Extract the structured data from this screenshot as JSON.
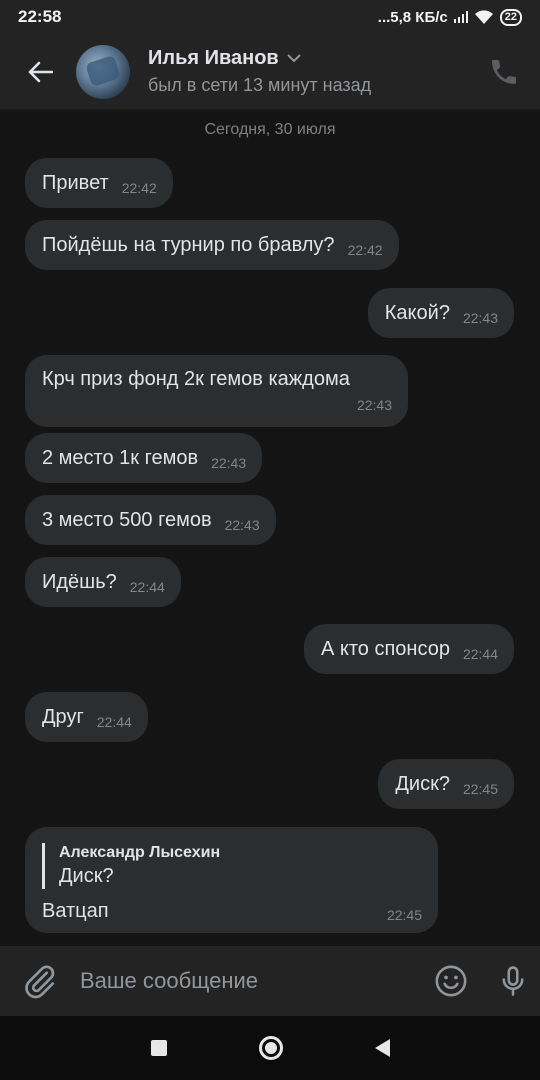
{
  "status_bar": {
    "time": "22:58",
    "network_speed": "...5,8 КБ/с",
    "battery": "22"
  },
  "header": {
    "name": "Илья Иванов",
    "status": "был в сети 13 минут назад"
  },
  "date_separator": "Сегодня, 30 июля",
  "messages": [
    {
      "text": "Привет",
      "time": "22:42",
      "side": "in"
    },
    {
      "text": "Пойдёшь на турнир по бравлу?",
      "time": "22:42",
      "side": "in"
    },
    {
      "text": "Какой?",
      "time": "22:43",
      "side": "out"
    },
    {
      "text": "Крч приз фонд 2к гемов каждома",
      "time": "22:43",
      "side": "in"
    },
    {
      "text": "2 место 1к гемов",
      "time": "22:43",
      "side": "in"
    },
    {
      "text": "3 место 500 гемов",
      "time": "22:43",
      "side": "in"
    },
    {
      "text": "Идёшь?",
      "time": "22:44",
      "side": "in"
    },
    {
      "text": "А кто спонсор",
      "time": "22:44",
      "side": "out"
    },
    {
      "text": "Друг",
      "time": "22:44",
      "side": "in"
    },
    {
      "text": "Диск?",
      "time": "22:45",
      "side": "out"
    },
    {
      "text": "Ватцап",
      "time": "22:45",
      "side": "in",
      "reply": {
        "author": "Александр Лысехин",
        "text": "Диск?"
      }
    }
  ],
  "composer": {
    "placeholder": "Ваше сообщение"
  },
  "icons": {
    "back": "back-arrow-icon",
    "call": "phone-icon",
    "attach": "paperclip-icon",
    "emoji": "emoji-icon",
    "mic": "microphone-icon"
  },
  "colors": {
    "background": "#141414",
    "bubble": "#2c2d2e",
    "header": "#232324"
  }
}
